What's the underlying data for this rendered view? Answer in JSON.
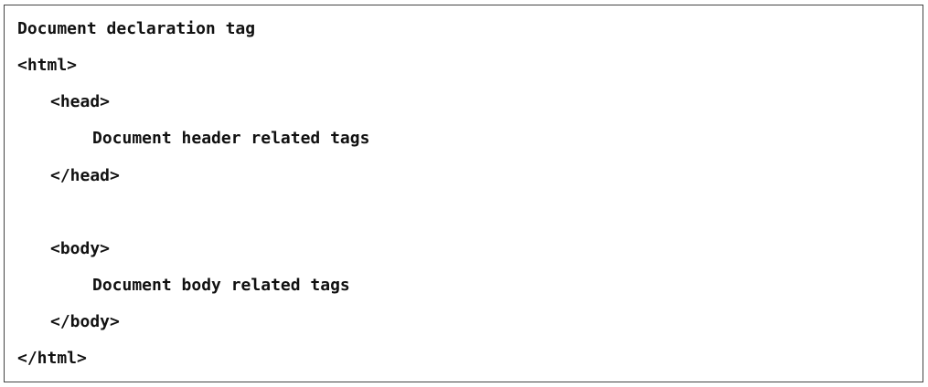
{
  "document": {
    "lines": [
      "Document declaration tag",
      "<html>",
      "<head>",
      "Document header related tags",
      "</head>",
      "",
      "<body>",
      "Document body related tags",
      "</body>",
      "</html>"
    ]
  }
}
